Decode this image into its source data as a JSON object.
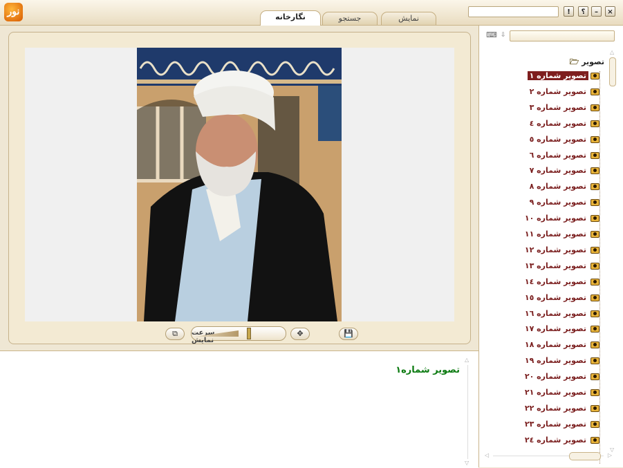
{
  "window": {
    "logo_text": "نور",
    "close_label": "×",
    "minimize_label": "–",
    "help_label": "؟",
    "info_label": "!"
  },
  "tabs": [
    {
      "label": "نمایش",
      "active": false
    },
    {
      "label": "جستجو",
      "active": false
    },
    {
      "label": "نگارخانه",
      "active": true
    }
  ],
  "search": {
    "value": "",
    "placeholder": ""
  },
  "viewer": {
    "speed_label": "سرعت نمایش",
    "speed_level": 0.6
  },
  "caption": {
    "text": "تصویر شماره۱"
  },
  "tree": {
    "root_label": "تصویر",
    "items": [
      "تصویر شماره ۱",
      "تصویر شماره ۲",
      "تصویر شماره ۳",
      "تصویر شماره ٤",
      "تصویر شماره ٥",
      "تصویر شماره ٦",
      "تصویر شماره ۷",
      "تصویر شماره ۸",
      "تصویر شماره ۹",
      "تصویر شماره ۱۰",
      "تصویر شماره ۱۱",
      "تصویر شماره ۱۲",
      "تصویر شماره ۱۳",
      "تصویر شماره ١٤",
      "تصویر شماره ١٥",
      "تصویر شماره ١٦",
      "تصویر شماره ۱۷",
      "تصویر شماره ۱۸",
      "تصویر شماره ۱۹",
      "تصویر شماره ۲۰",
      "تصویر شماره ۲۱",
      "تصویر شماره ۲۲",
      "تصویر شماره ۲۳",
      "تصویر شماره ۲٤"
    ],
    "selected_index": 0
  },
  "colors": {
    "selected_bg": "#7e1e1e",
    "item_text": "#7a1e1e",
    "caption_text": "#0b7a10"
  }
}
